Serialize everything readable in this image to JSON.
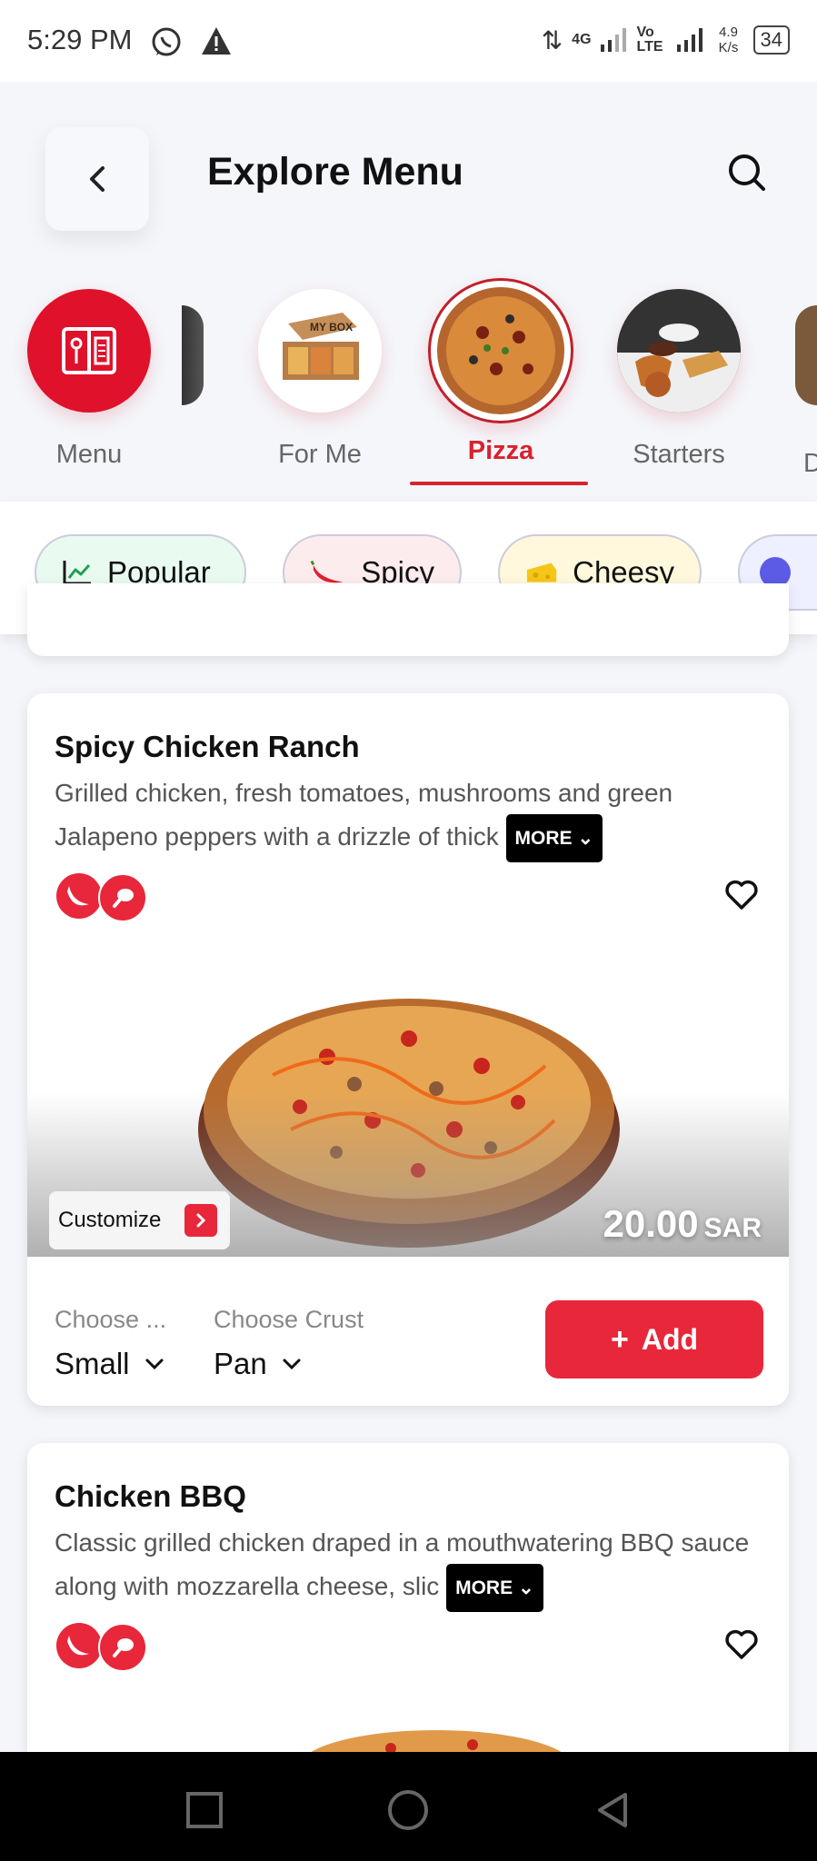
{
  "status_bar": {
    "time": "5:29 PM",
    "network_4g": "4G",
    "network_volte": "Vo LTE",
    "speed": "4.9 K/s",
    "battery": "34"
  },
  "header": {
    "title": "Explore Menu"
  },
  "categories": [
    {
      "label": "Menu"
    },
    {
      "label": "For Me"
    },
    {
      "label": "Pizza",
      "active": true
    },
    {
      "label": "Starters"
    },
    {
      "label": "D"
    }
  ],
  "filters": [
    {
      "label": "Popular"
    },
    {
      "label": "Spicy"
    },
    {
      "label": "Cheesy"
    }
  ],
  "products": [
    {
      "name": "Spicy Chicken Ranch",
      "description": "Grilled chicken, fresh tomatoes, mushrooms and green Jalapeno peppers with a drizzle of thick",
      "more_label": "MORE",
      "customize_label": "Customize",
      "price": "20.00",
      "currency": "SAR",
      "size_label": "Choose ...",
      "size_value": "Small",
      "crust_label": "Choose Crust",
      "crust_value": "Pan",
      "add_label": "Add"
    },
    {
      "name": "Chicken BBQ",
      "description": "Classic grilled chicken draped in a mouthwatering BBQ sauce along with mozzarella cheese, slic",
      "more_label": "MORE"
    }
  ],
  "colors": {
    "accent": "#e8273a",
    "background": "#f4f6fa"
  }
}
